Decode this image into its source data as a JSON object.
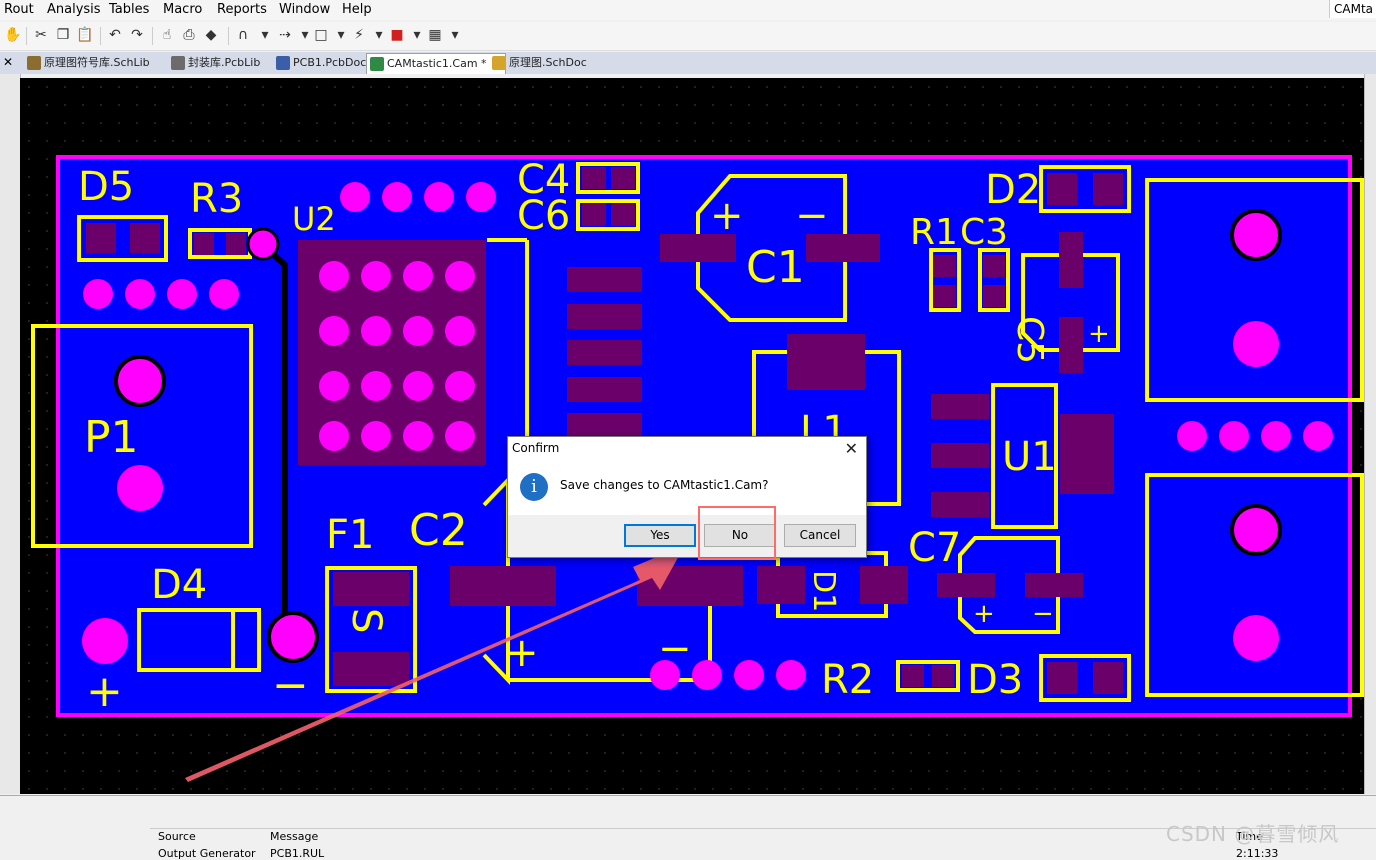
{
  "menu": [
    "Rout",
    "Analysis",
    "Tables",
    "Macro",
    "Reports",
    "Window",
    "Help"
  ],
  "app_title_right": "CAMta",
  "tabs": [
    {
      "label": "原理图符号库.SchLib",
      "icon_color": "#8a6d2f"
    },
    {
      "label": "封装库.PcbLib",
      "icon_color": "#6b6b6b"
    },
    {
      "label": "PCB1.PcbDoc",
      "icon_color": "#3b5ea8"
    },
    {
      "label": "CAMtastic1.Cam *",
      "icon_color": "#2f8a45"
    },
    {
      "label": "原理图.SchDoc",
      "icon_color": "#d4a52a"
    }
  ],
  "pcb": {
    "labels": {
      "D5": "D5",
      "R3": "R3",
      "U2": "U2",
      "C4": "C4",
      "C6": "C6",
      "C1": "C1",
      "R1": "R1",
      "C3": "C3",
      "D2": "D2",
      "C5": "C5",
      "P1": "P1",
      "L1": "L1",
      "U1": "U1",
      "F1": "F1",
      "C2": "C2",
      "D4": "D4",
      "C7": "C7",
      "D1": "D1",
      "R2": "R2",
      "D3": "D3",
      "plus": "+",
      "minus": "−",
      "s": "S"
    }
  },
  "dialog": {
    "title": "Confirm",
    "message": "Save changes to CAMtastic1.Cam?",
    "yes": "Yes",
    "no": "No",
    "cancel": "Cancel"
  },
  "bottom_panel": {
    "headers": {
      "source": "Source",
      "message": "Message",
      "time": "Time"
    },
    "row": {
      "source": "Output Generator",
      "message": "PCB1.RUL",
      "time": "2:11:33"
    }
  },
  "watermark": "CSDN @暮雪倾风",
  "colors": {
    "board": "#0000ff",
    "silk": "#ffff00",
    "pad": "#ff00ff",
    "smd": "#6b006b",
    "outline": "#ff00ff",
    "arrow": "#f0606a"
  }
}
